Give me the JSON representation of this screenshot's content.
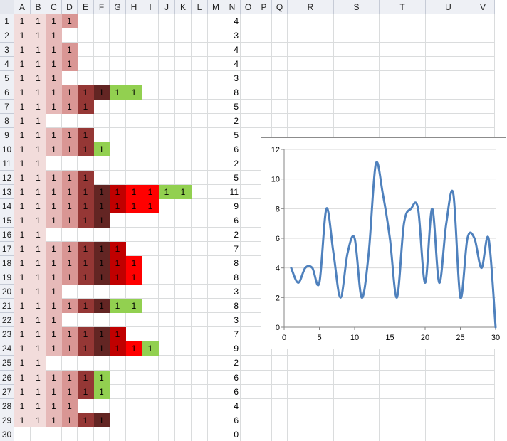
{
  "column_headers": [
    "A",
    "B",
    "C",
    "D",
    "E",
    "F",
    "G",
    "H",
    "I",
    "J",
    "K",
    "L",
    "M",
    "N",
    "O",
    "P",
    "Q",
    "R",
    "S",
    "T",
    "U",
    "V"
  ],
  "row_headers": [
    "1",
    "2",
    "3",
    "4",
    "5",
    "6",
    "7",
    "8",
    "9",
    "10",
    "11",
    "12",
    "13",
    "14",
    "15",
    "16",
    "17",
    "18",
    "19",
    "20",
    "21",
    "22",
    "23",
    "24",
    "25",
    "26",
    "27",
    "28",
    "29",
    "30"
  ],
  "fill_colors": {
    "A": "#f2dcdb",
    "B": "#f2dcdb",
    "C": "#e6b9b8",
    "D": "#d99694",
    "E": "#953735",
    "F": "#632523",
    "G": "#c00000",
    "H": "#ff0000",
    "I": "#ff0000",
    "green": "#92d050"
  },
  "grid_rows": [
    {
      "ones": [
        "A",
        "B",
        "C",
        "D"
      ],
      "green": [],
      "count": "4"
    },
    {
      "ones": [
        "A",
        "B",
        "C"
      ],
      "green": [],
      "count": "3"
    },
    {
      "ones": [
        "A",
        "B",
        "C",
        "D"
      ],
      "green": [],
      "count": "4"
    },
    {
      "ones": [
        "A",
        "B",
        "C",
        "D"
      ],
      "green": [],
      "count": "4"
    },
    {
      "ones": [
        "A",
        "B",
        "C"
      ],
      "green": [],
      "count": "3"
    },
    {
      "ones": [
        "A",
        "B",
        "C",
        "D",
        "E",
        "F"
      ],
      "green": [
        "G",
        "H"
      ],
      "count": "8"
    },
    {
      "ones": [
        "A",
        "B",
        "C",
        "D",
        "E"
      ],
      "green": [],
      "count": "5"
    },
    {
      "ones": [
        "A",
        "B"
      ],
      "green": [],
      "count": "2"
    },
    {
      "ones": [
        "A",
        "B",
        "C",
        "D",
        "E"
      ],
      "green": [],
      "count": "5"
    },
    {
      "ones": [
        "A",
        "B",
        "C",
        "D",
        "E"
      ],
      "green": [
        "F"
      ],
      "count": "6"
    },
    {
      "ones": [
        "A",
        "B"
      ],
      "green": [],
      "count": "2"
    },
    {
      "ones": [
        "A",
        "B",
        "C",
        "D",
        "E"
      ],
      "green": [],
      "count": "5"
    },
    {
      "ones": [
        "A",
        "B",
        "C",
        "D",
        "E",
        "F",
        "G",
        "H",
        "I"
      ],
      "green": [
        "J",
        "K"
      ],
      "count": "11"
    },
    {
      "ones": [
        "A",
        "B",
        "C",
        "D",
        "E",
        "F",
        "G",
        "H",
        "I"
      ],
      "green": [],
      "count": "9"
    },
    {
      "ones": [
        "A",
        "B",
        "C",
        "D",
        "E",
        "F"
      ],
      "green": [],
      "count": "6"
    },
    {
      "ones": [
        "A",
        "B"
      ],
      "green": [],
      "count": "2"
    },
    {
      "ones": [
        "A",
        "B",
        "C",
        "D",
        "E",
        "F",
        "G"
      ],
      "green": [],
      "count": "7"
    },
    {
      "ones": [
        "A",
        "B",
        "C",
        "D",
        "E",
        "F",
        "G",
        "H"
      ],
      "green": [],
      "count": "8"
    },
    {
      "ones": [
        "A",
        "B",
        "C",
        "D",
        "E",
        "F",
        "G",
        "H"
      ],
      "green": [],
      "count": "8"
    },
    {
      "ones": [
        "A",
        "B",
        "C"
      ],
      "green": [],
      "count": "3"
    },
    {
      "ones": [
        "A",
        "B",
        "C",
        "D",
        "E",
        "F"
      ],
      "green": [
        "G",
        "H"
      ],
      "count": "8"
    },
    {
      "ones": [
        "A",
        "B",
        "C"
      ],
      "green": [],
      "count": "3"
    },
    {
      "ones": [
        "A",
        "B",
        "C",
        "D",
        "E",
        "F",
        "G"
      ],
      "green": [],
      "count": "7"
    },
    {
      "ones": [
        "A",
        "B",
        "C",
        "D",
        "E",
        "F",
        "G",
        "H"
      ],
      "green": [
        "I"
      ],
      "count": "9"
    },
    {
      "ones": [
        "A",
        "B"
      ],
      "green": [],
      "count": "2"
    },
    {
      "ones": [
        "A",
        "B",
        "C",
        "D",
        "E"
      ],
      "green": [
        "F"
      ],
      "count": "6"
    },
    {
      "ones": [
        "A",
        "B",
        "C",
        "D",
        "E"
      ],
      "green": [
        "F"
      ],
      "count": "6"
    },
    {
      "ones": [
        "A",
        "B",
        "C",
        "D"
      ],
      "green": [],
      "count": "4"
    },
    {
      "ones": [
        "A",
        "B",
        "C",
        "D",
        "E",
        "F"
      ],
      "green": [],
      "count": "6"
    },
    {
      "ones": [],
      "green": [],
      "count": "0"
    }
  ],
  "cell_value": "1",
  "chart_data": {
    "type": "line",
    "x": [
      1,
      2,
      3,
      4,
      5,
      6,
      7,
      8,
      9,
      10,
      11,
      12,
      13,
      14,
      15,
      16,
      17,
      18,
      19,
      20,
      21,
      22,
      23,
      24,
      25,
      26,
      27,
      28,
      29,
      30
    ],
    "series": [
      {
        "values": [
          4,
          3,
          4,
          4,
          3,
          8,
          5,
          2,
          5,
          6,
          2,
          5,
          11,
          9,
          6,
          2,
          7,
          8,
          8,
          3,
          8,
          3,
          7,
          9,
          2,
          6,
          6,
          4,
          6,
          0
        ],
        "color": "#4f81bd"
      }
    ],
    "xlim": [
      0,
      30
    ],
    "ylim": [
      0,
      12
    ],
    "x_ticks": [
      "0",
      "5",
      "10",
      "15",
      "20",
      "25",
      "30"
    ],
    "y_ticks": [
      "0",
      "2",
      "4",
      "6",
      "8",
      "10",
      "12"
    ],
    "grid": "horizontal",
    "legend": "none",
    "title": "",
    "xlabel": "",
    "ylabel": ""
  }
}
